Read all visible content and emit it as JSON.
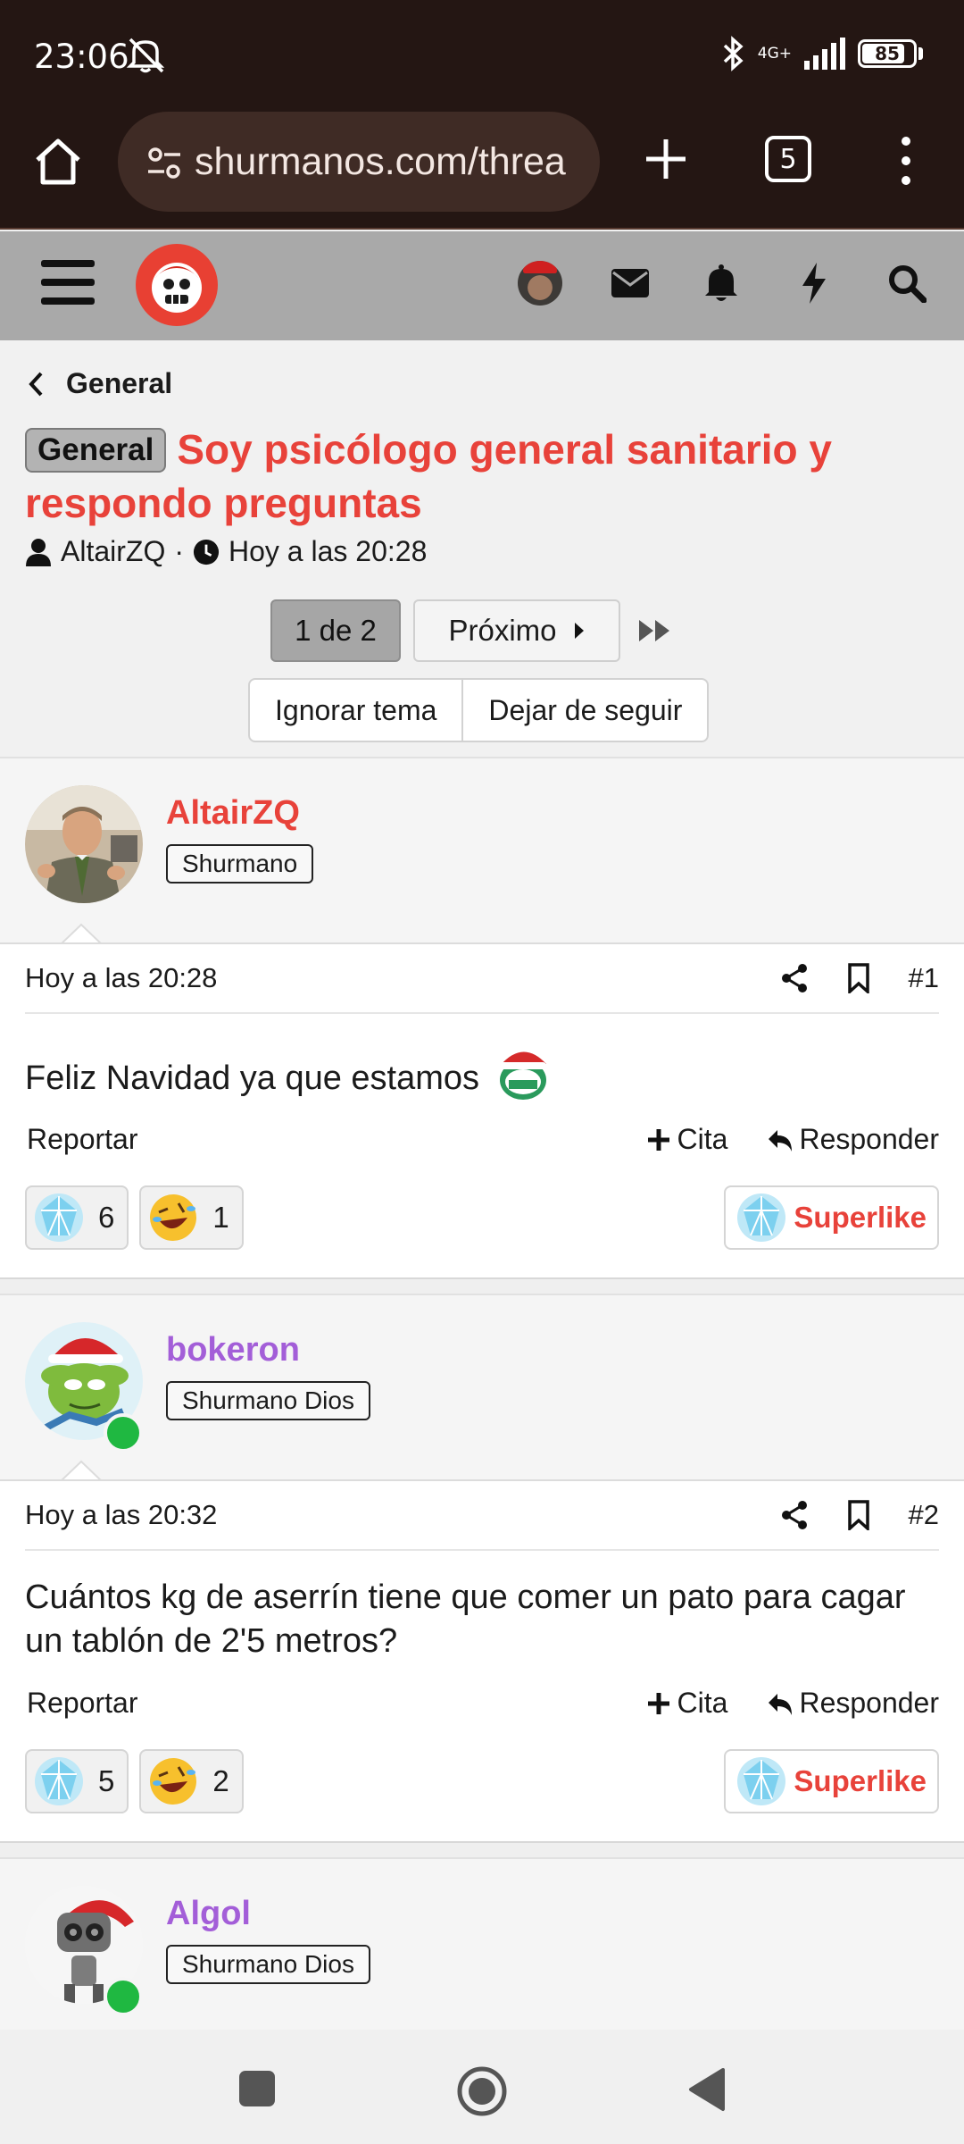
{
  "status": {
    "time": "23:06",
    "network": "4G+",
    "battery": "85",
    "battery_level": 0.85
  },
  "browser": {
    "url": "shurmanos.com/threa",
    "tab_count": "5"
  },
  "header": {
    "icons": [
      "menu-icon",
      "logo",
      "user-avatar",
      "mail-icon",
      "bell-icon",
      "bolt-icon",
      "search-icon"
    ]
  },
  "thread": {
    "breadcrumb": "General",
    "prefix": "General",
    "title": "Soy psicólogo general sanitario y respondo preguntas",
    "author": "AltairZQ",
    "separator": "·",
    "time": "Hoy a las 20:28",
    "pager": {
      "current": "1 de 2",
      "next": "Próximo"
    },
    "buttons": {
      "ignore": "Ignorar tema",
      "unfollow": "Dejar de seguir"
    }
  },
  "posts": [
    {
      "user": "AltairZQ",
      "user_color": "#e8423a",
      "rank": "Shurmano",
      "online": false,
      "date": "Hoy a las 20:28",
      "number": "#1",
      "text": "Feliz Navidad ya que estamos",
      "report": "Reportar",
      "quote": "Cita",
      "reply": "Responder",
      "reactions": [
        {
          "icon": "diamond-icon",
          "count": "6"
        },
        {
          "icon": "laugh-emoji-icon",
          "count": "1"
        }
      ],
      "superlike": "Superlike"
    },
    {
      "user": "bokeron",
      "user_color": "#a35ed8",
      "rank": "Shurmano Dios",
      "online": true,
      "date": "Hoy a las 20:32",
      "number": "#2",
      "text": "Cuántos kg de aserrín tiene que comer un pato para cagar un tablón de 2'5 metros?",
      "report": "Reportar",
      "quote": "Cita",
      "reply": "Responder",
      "reactions": [
        {
          "icon": "diamond-icon",
          "count": "5"
        },
        {
          "icon": "laugh-emoji-icon",
          "count": "2"
        }
      ],
      "superlike": "Superlike"
    },
    {
      "user": "Algol",
      "user_color": "#a35ed8",
      "rank": "Shurmano Dios",
      "online": true
    }
  ],
  "colors": {
    "accent": "#e8423a",
    "purple_user": "#a35ed8",
    "browser_bg": "#241613",
    "header_bg": "#a9a9a9",
    "online": "#1fb841"
  }
}
